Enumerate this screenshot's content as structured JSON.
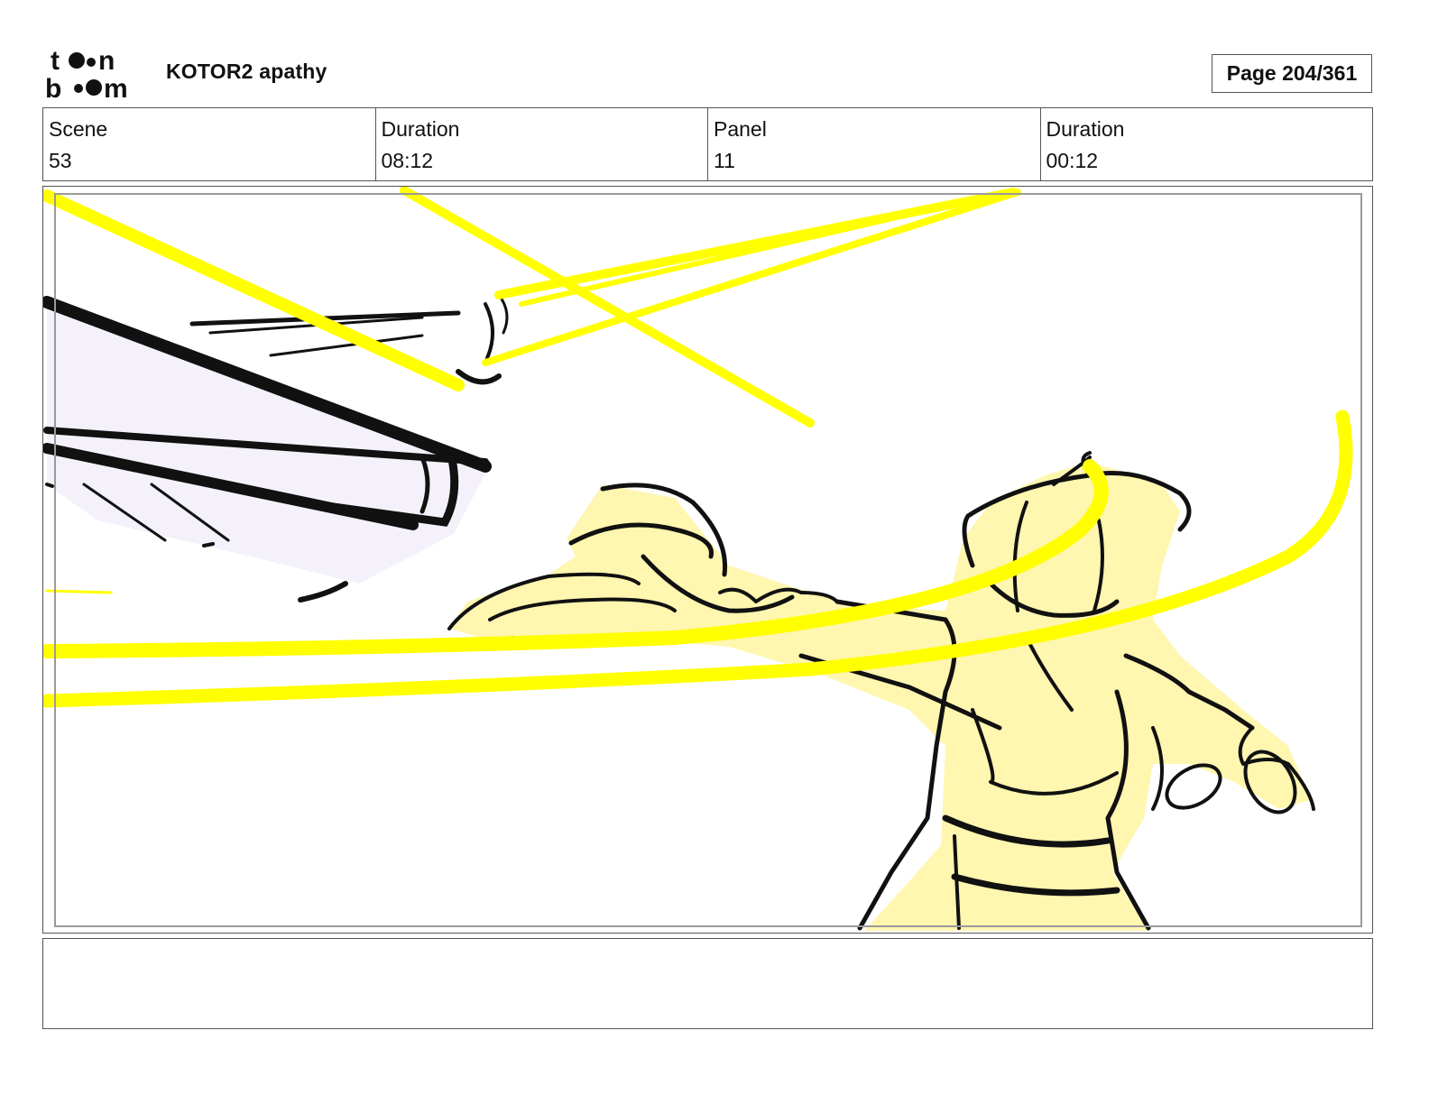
{
  "header": {
    "logo": {
      "icon": "toonboom-logo-icon",
      "line1": "toon",
      "line2": "boom"
    },
    "project_title": "KOTOR2 apathy",
    "page_label": "Page 204/361"
  },
  "info": {
    "scene_label": "Scene",
    "scene_value": "53",
    "scene_duration_label": "Duration",
    "scene_duration_value": "08:12",
    "panel_label": "Panel",
    "panel_value": "11",
    "panel_duration_label": "Duration",
    "panel_duration_value": "00:12"
  },
  "panel": {
    "image_icon": "storyboard-sketch-icon",
    "colors": {
      "light_streak": "#ffff00",
      "figure_fill": "#fff6b0",
      "shadow_fill": "#f4f1fb",
      "ink": "#111111"
    }
  },
  "dialogue": {
    "text": ""
  }
}
